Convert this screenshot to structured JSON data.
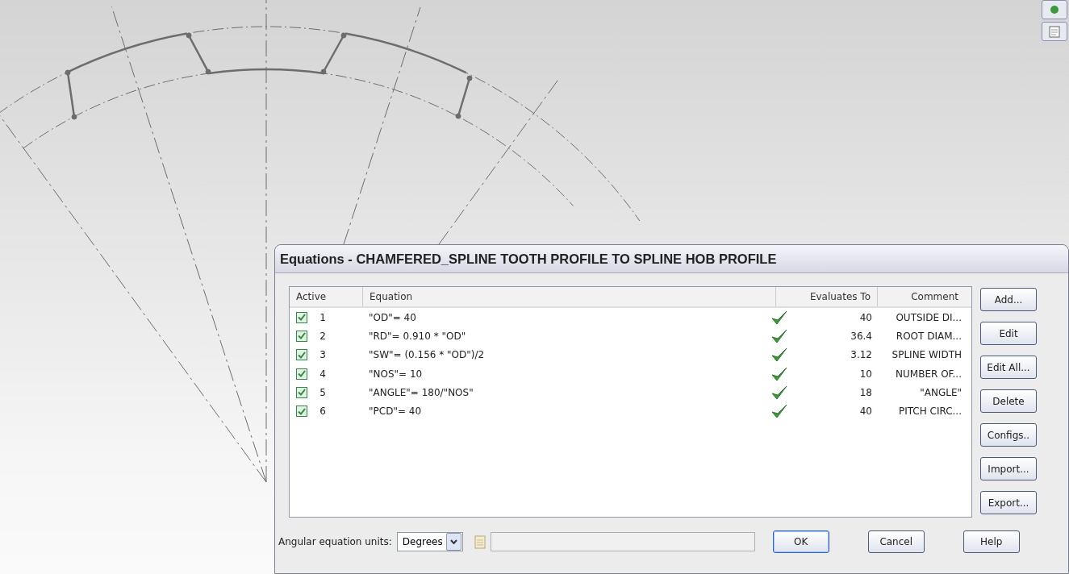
{
  "dialog": {
    "title": "Equations - CHAMFERED_SPLINE TOOTH PROFILE TO SPLINE HOB PROFILE",
    "columns": [
      "Active",
      "Equation",
      "Evaluates To",
      "Comment"
    ],
    "rows": [
      {
        "active": true,
        "number": "1",
        "equation": "\"OD\"= 40",
        "valid": true,
        "value": "40",
        "comment": "OUTSIDE DI..."
      },
      {
        "active": true,
        "number": "2",
        "equation": "\"RD\"= 0.910 * \"OD\"",
        "valid": true,
        "value": "36.4",
        "comment": "ROOT DIAM..."
      },
      {
        "active": true,
        "number": "3",
        "equation": "\"SW\"= (0.156 * \"OD\")/2",
        "valid": true,
        "value": "3.12",
        "comment": "SPLINE WIDTH"
      },
      {
        "active": true,
        "number": "4",
        "equation": "\"NOS\"= 10",
        "valid": true,
        "value": "10",
        "comment": "NUMBER OF..."
      },
      {
        "active": true,
        "number": "5",
        "equation": "\"ANGLE\"= 180/\"NOS\"",
        "valid": true,
        "value": "18",
        "comment": "\"ANGLE\""
      },
      {
        "active": true,
        "number": "6",
        "equation": "\"PCD\"= 40",
        "valid": true,
        "value": "40",
        "comment": "PITCH CIRC..."
      }
    ],
    "side_buttons": [
      "Add...",
      "Edit",
      "Edit All...",
      "Delete",
      "Configs..",
      "Import...",
      "Export..."
    ],
    "units_label": "Angular equation units:",
    "units_value": "Degrees",
    "bottom_buttons": [
      {
        "label": "OK",
        "default": true
      },
      {
        "label": "Cancel",
        "default": false
      },
      {
        "label": "Help",
        "default": false
      }
    ]
  }
}
